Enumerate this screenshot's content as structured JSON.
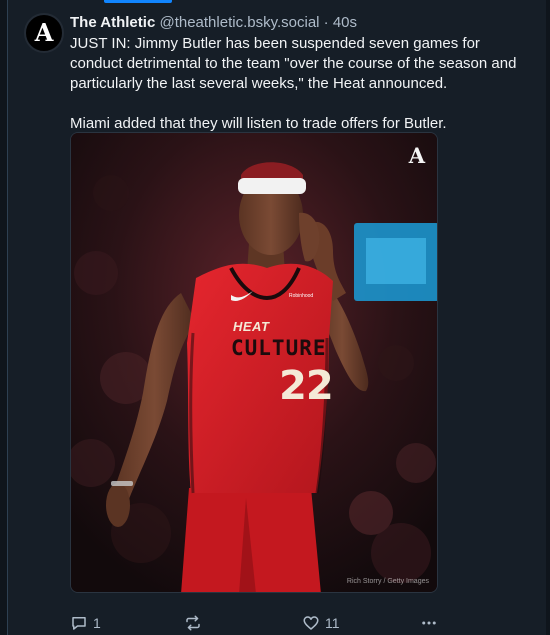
{
  "post": {
    "author": {
      "display_name": "The Athletic",
      "handle": "@theathletic.bsky.social",
      "avatar_letter": "A"
    },
    "separator": "·",
    "time": "40s",
    "text_paragraphs": [
      "JUST IN: Jimmy Butler has been suspended seven games for conduct detrimental to the team \"over the course of the season and particularly the last several weeks,\" the Heat announced.",
      "Miami added that they will listen to trade offers for Butler."
    ],
    "media": {
      "watermark": "A",
      "credit": "Rich Storry / Getty Images",
      "jersey": {
        "brand": "HEAT",
        "team": "CULTURE",
        "number": "22",
        "sponsor": "Robinhood"
      }
    },
    "actions": {
      "reply_count": "1",
      "repost_count": "",
      "like_count": "11",
      "more_icon": "ellipsis-icon"
    }
  },
  "colors": {
    "background": "#161e27",
    "text": "#f1f3f5",
    "secondary_text": "#aebbc9",
    "accent": "#1185fe",
    "jersey_red": "#d91f26"
  }
}
